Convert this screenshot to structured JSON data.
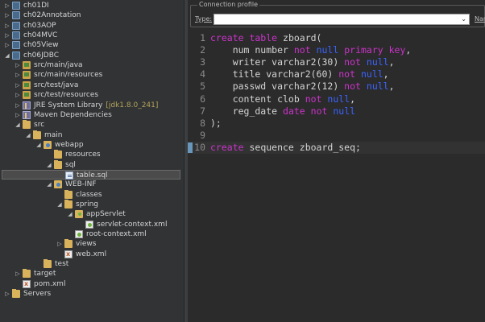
{
  "explorer": {
    "items": [
      {
        "label": "ch01DI",
        "decoration": "",
        "icon": "project-icon",
        "chevron": "right"
      },
      {
        "label": "ch02Annotation",
        "decoration": "",
        "icon": "project-icon",
        "chevron": "right"
      },
      {
        "label": "ch03AOP",
        "decoration": "",
        "icon": "project-icon",
        "chevron": "right"
      },
      {
        "label": "ch04MVC",
        "decoration": "",
        "icon": "project-icon",
        "chevron": "right"
      },
      {
        "label": "ch05View",
        "decoration": "",
        "icon": "project-icon",
        "chevron": "right"
      },
      {
        "label": "ch06JDBC",
        "decoration": "",
        "icon": "project-icon",
        "chevron": "down"
      },
      {
        "label": "src/main/java",
        "decoration": "",
        "icon": "source-folder-icon",
        "chevron": "right"
      },
      {
        "label": "src/main/resources",
        "decoration": "",
        "icon": "source-folder-icon",
        "chevron": "right"
      },
      {
        "label": "src/test/java",
        "decoration": "",
        "icon": "source-folder-icon",
        "chevron": "right"
      },
      {
        "label": "src/test/resources",
        "decoration": "",
        "icon": "source-folder-icon",
        "chevron": "right"
      },
      {
        "label": "JRE System Library",
        "decoration": "[jdk1.8.0_241]",
        "icon": "library-icon",
        "chevron": "right"
      },
      {
        "label": "Maven Dependencies",
        "decoration": "",
        "icon": "library-icon",
        "chevron": "right"
      },
      {
        "label": "src",
        "decoration": "",
        "icon": "folder-icon",
        "chevron": "down"
      },
      {
        "label": "main",
        "decoration": "",
        "icon": "folder-icon",
        "chevron": "down"
      },
      {
        "label": "webapp",
        "decoration": "",
        "icon": "web-folder-icon",
        "chevron": "down"
      },
      {
        "label": "resources",
        "decoration": "",
        "icon": "folder-icon",
        "chevron": ""
      },
      {
        "label": "sql",
        "decoration": "",
        "icon": "folder-icon",
        "chevron": "down"
      },
      {
        "label": "table.sql",
        "decoration": "",
        "icon": "sql-file-icon",
        "chevron": ""
      },
      {
        "label": "WEB-INF",
        "decoration": "",
        "icon": "web-folder-icon",
        "chevron": "down"
      },
      {
        "label": "classes",
        "decoration": "",
        "icon": "folder-icon",
        "chevron": ""
      },
      {
        "label": "spring",
        "decoration": "",
        "icon": "folder-icon",
        "chevron": "down"
      },
      {
        "label": "appServlet",
        "decoration": "",
        "icon": "spring-folder-icon",
        "chevron": "down"
      },
      {
        "label": "servlet-context.xml",
        "decoration": "",
        "icon": "spring-xml-icon",
        "chevron": ""
      },
      {
        "label": "root-context.xml",
        "decoration": "",
        "icon": "spring-xml-icon",
        "chevron": ""
      },
      {
        "label": "views",
        "decoration": "",
        "icon": "folder-icon",
        "chevron": "right"
      },
      {
        "label": "web.xml",
        "decoration": "",
        "icon": "xml-file-icon",
        "chevron": ""
      },
      {
        "label": "test",
        "decoration": "",
        "icon": "folder-icon",
        "chevron": ""
      },
      {
        "label": "target",
        "decoration": "",
        "icon": "folder-icon",
        "chevron": "right"
      },
      {
        "label": "pom.xml",
        "decoration": "",
        "icon": "xml-file-icon",
        "chevron": ""
      },
      {
        "label": "Servers",
        "decoration": "",
        "icon": "folder-icon",
        "chevron": "right"
      }
    ]
  },
  "connection": {
    "legend": "Connection profile",
    "type_label": "Type:",
    "type_value": "",
    "name_label": "Nam"
  },
  "editor": {
    "lines": [
      {
        "num": "1",
        "tokens": [
          {
            "t": "create table",
            "c": "kw"
          },
          {
            "t": " zboard(",
            "c": "plain"
          }
        ]
      },
      {
        "num": "2",
        "tokens": [
          {
            "t": "    num number ",
            "c": "plain"
          },
          {
            "t": "not",
            "c": "kw"
          },
          {
            "t": " ",
            "c": "plain"
          },
          {
            "t": "null",
            "c": "nul"
          },
          {
            "t": " ",
            "c": "plain"
          },
          {
            "t": "primary key",
            "c": "kw"
          },
          {
            "t": ",",
            "c": "plain"
          }
        ]
      },
      {
        "num": "3",
        "tokens": [
          {
            "t": "    writer varchar2(30) ",
            "c": "plain"
          },
          {
            "t": "not",
            "c": "kw"
          },
          {
            "t": " ",
            "c": "plain"
          },
          {
            "t": "null",
            "c": "nul"
          },
          {
            "t": ",",
            "c": "plain"
          }
        ]
      },
      {
        "num": "4",
        "tokens": [
          {
            "t": "    title varchar2(60) ",
            "c": "plain"
          },
          {
            "t": "not",
            "c": "kw"
          },
          {
            "t": " ",
            "c": "plain"
          },
          {
            "t": "null",
            "c": "nul"
          },
          {
            "t": ",",
            "c": "plain"
          }
        ]
      },
      {
        "num": "5",
        "tokens": [
          {
            "t": "    passwd varchar2(12) ",
            "c": "plain"
          },
          {
            "t": "not",
            "c": "kw"
          },
          {
            "t": " ",
            "c": "plain"
          },
          {
            "t": "null",
            "c": "nul"
          },
          {
            "t": ",",
            "c": "plain"
          }
        ]
      },
      {
        "num": "6",
        "tokens": [
          {
            "t": "    content clob ",
            "c": "plain"
          },
          {
            "t": "not",
            "c": "kw"
          },
          {
            "t": " ",
            "c": "plain"
          },
          {
            "t": "null",
            "c": "nul"
          },
          {
            "t": ",",
            "c": "plain"
          }
        ]
      },
      {
        "num": "7",
        "tokens": [
          {
            "t": "    reg_date ",
            "c": "plain"
          },
          {
            "t": "date",
            "c": "kw"
          },
          {
            "t": " ",
            "c": "plain"
          },
          {
            "t": "not",
            "c": "kw"
          },
          {
            "t": " ",
            "c": "plain"
          },
          {
            "t": "null",
            "c": "nul"
          }
        ]
      },
      {
        "num": "8",
        "tokens": [
          {
            "t": ");",
            "c": "plain"
          }
        ]
      },
      {
        "num": "9",
        "tokens": []
      },
      {
        "num": "10",
        "tokens": [
          {
            "t": "create",
            "c": "kw"
          },
          {
            "t": " sequence zboard_seq;",
            "c": "plain"
          }
        ]
      }
    ]
  }
}
